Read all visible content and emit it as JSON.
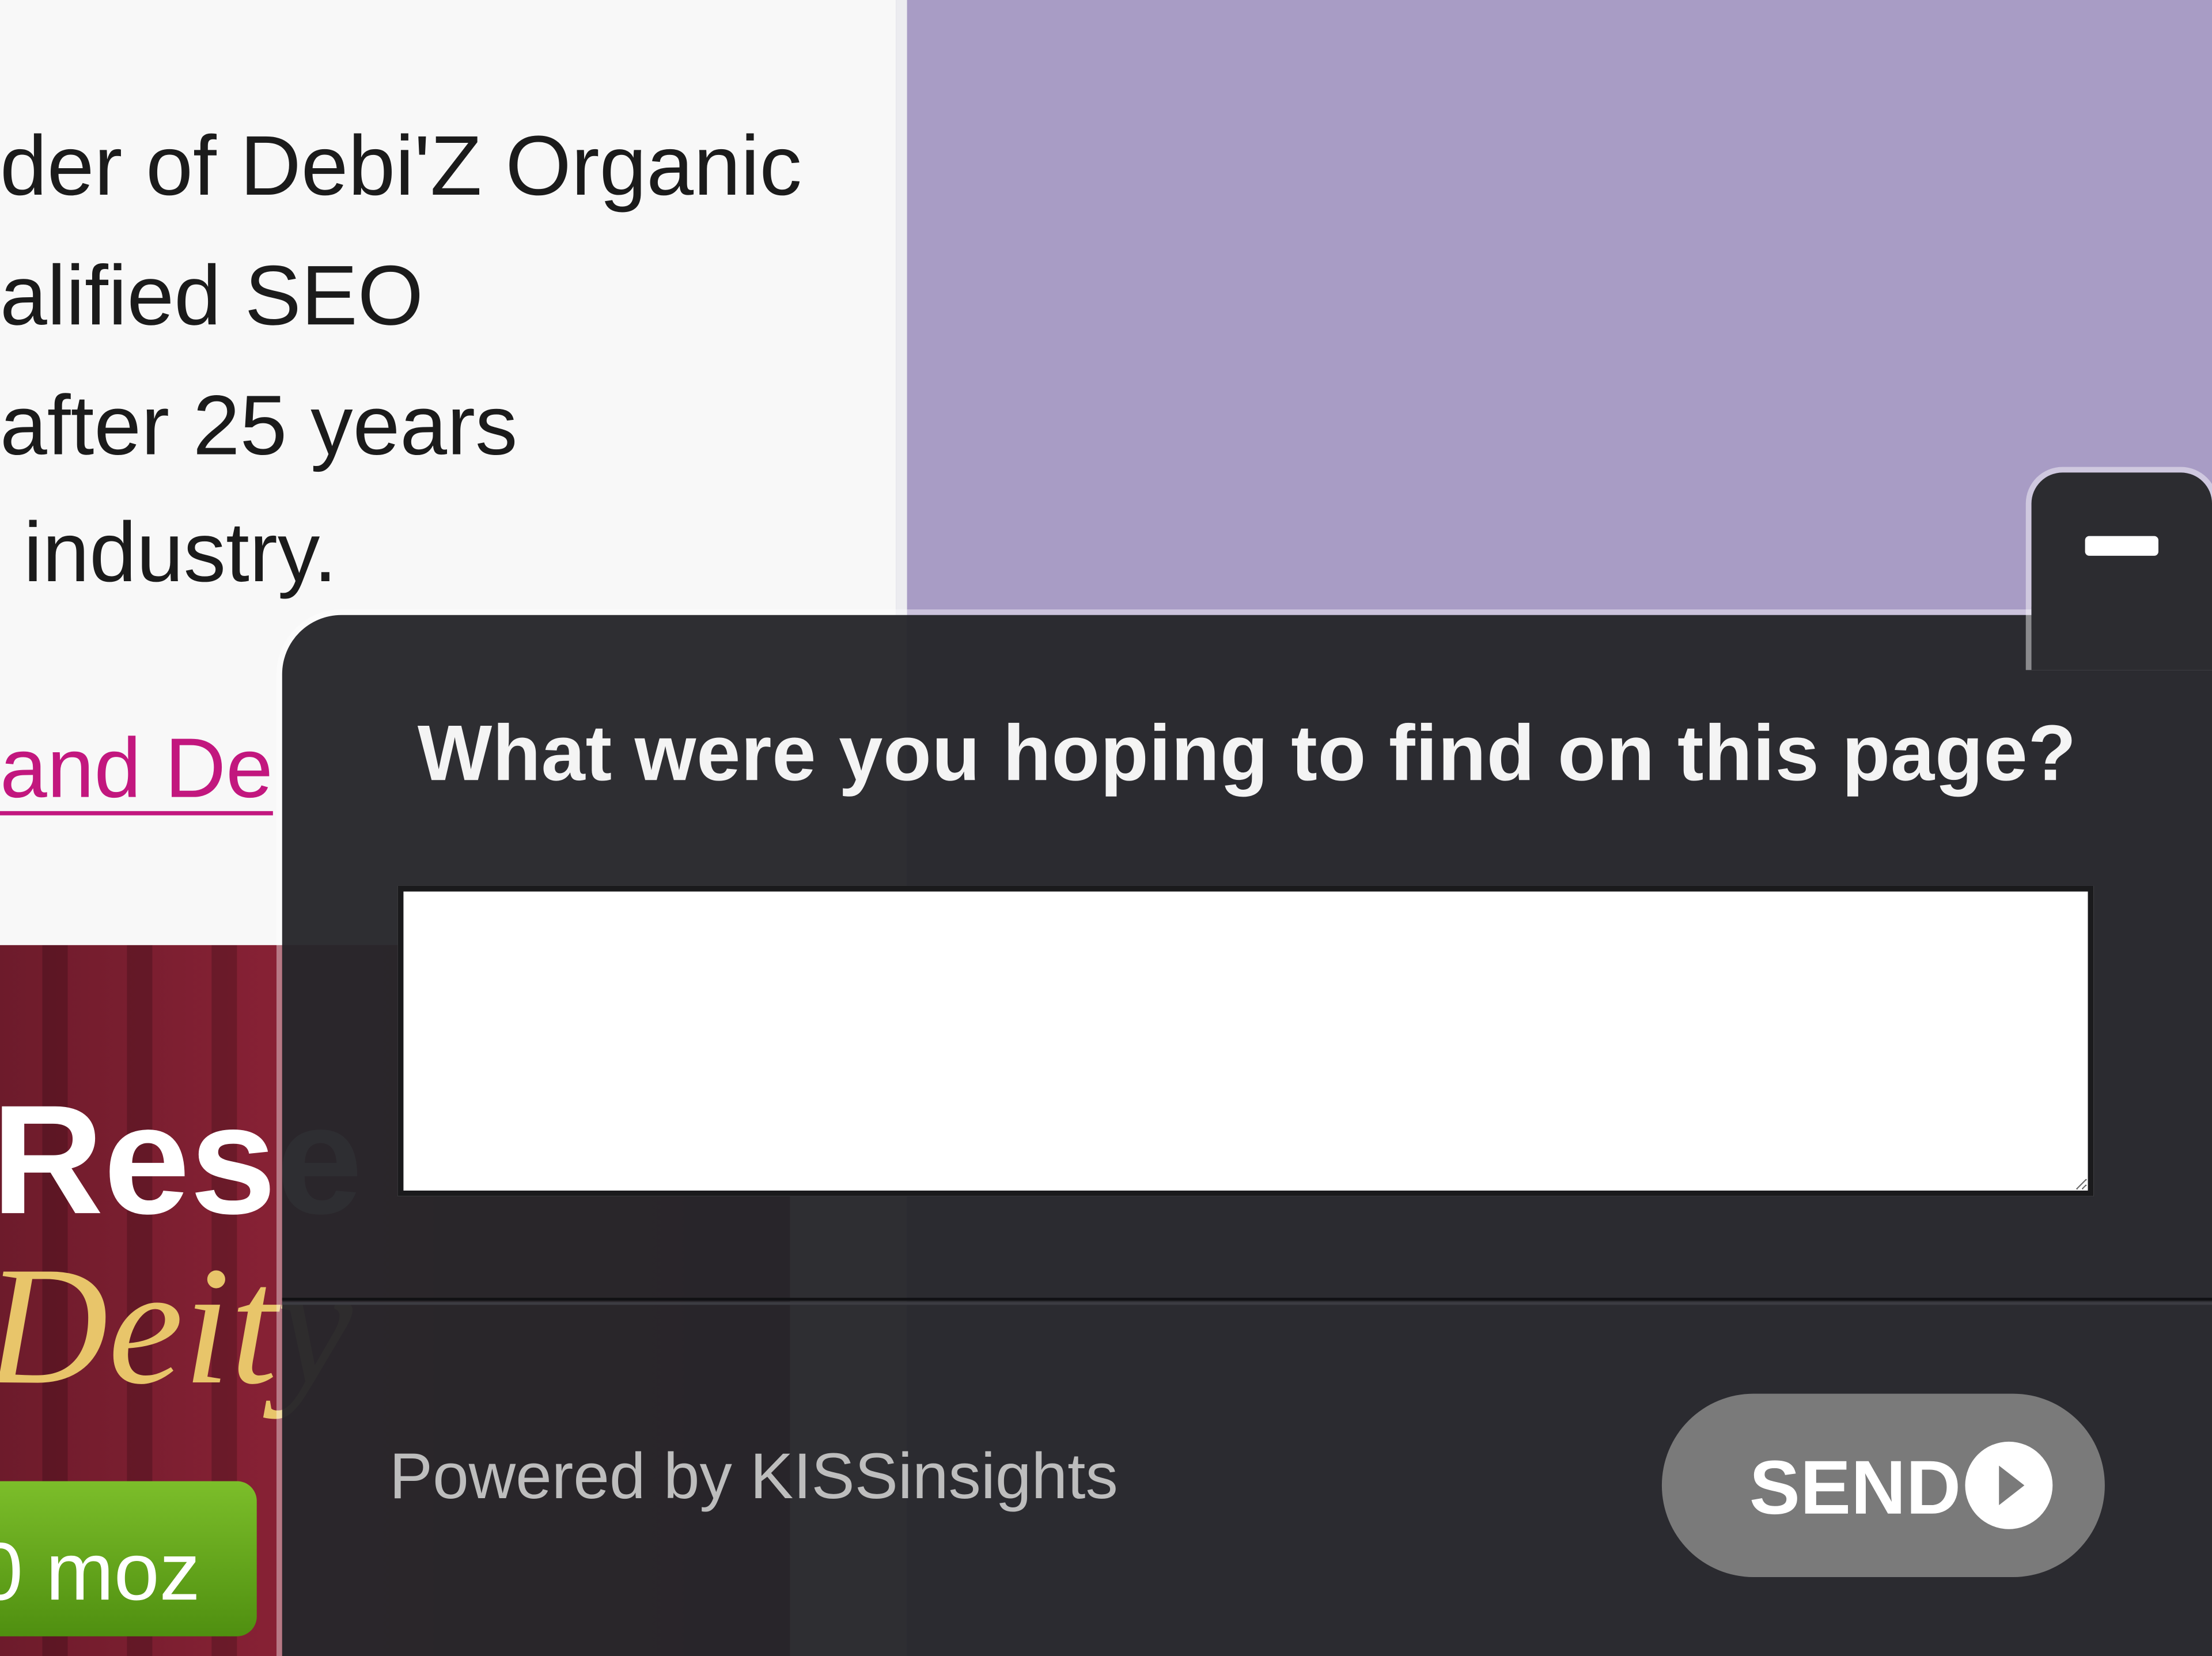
{
  "page": {
    "paragraph_lines": [
      "der of Debi'Z Organic",
      "alified SEO",
      "after 25 years",
      " industry."
    ],
    "link_text": "and De"
  },
  "banner": {
    "title": "Rese",
    "script": "Deity",
    "button_label": "0 moz"
  },
  "widget": {
    "question": "What were you hoping to find on this page?",
    "answer_value": "",
    "answer_placeholder": "",
    "powered_by": "Powered by KISSinsights",
    "send_label": "SEND"
  },
  "colors": {
    "page_background": "#a89cc5",
    "widget_background": "#26262a",
    "send_button": "#7a7a7a",
    "link": "#c2177e"
  }
}
